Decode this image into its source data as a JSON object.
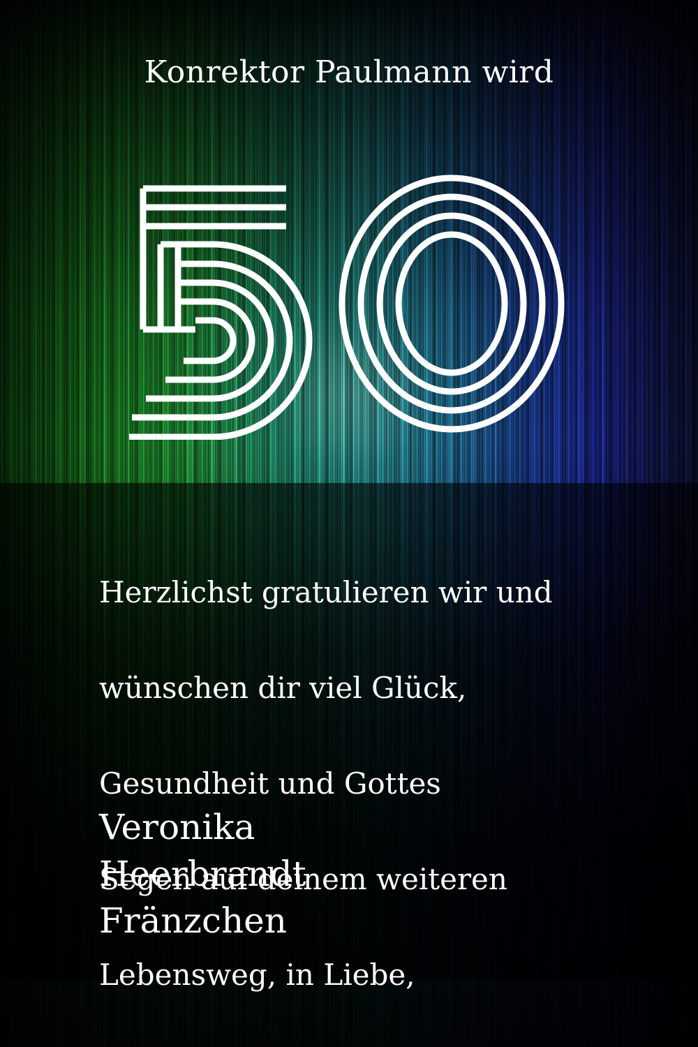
{
  "colors": {
    "text": "#ffffff",
    "green": "#24b640",
    "teal": "#2ab3b0",
    "blue": "#1c2ab8",
    "panel": "#000000"
  },
  "card": {
    "header": "Konrektor Paulmann wird",
    "age_numeral": "50",
    "message_lines": [
      "Herzlichst gratulieren wir und",
      "wünschen dir viel Glück,",
      "Gesundheit und Gottes",
      "Segen auf deinem weiteren",
      "Lebensweg, in Liebe,"
    ],
    "signatures": [
      "Veronika",
      "Heerbrandt",
      "Fränzchen"
    ]
  }
}
